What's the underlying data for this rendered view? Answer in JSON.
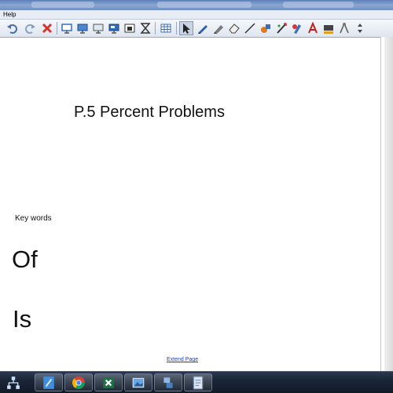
{
  "menubar": {
    "help_label": "Help"
  },
  "toolbar": {
    "tools": [
      "undo-icon",
      "redo-icon",
      "delete-icon",
      "screen-capture-icon",
      "monitor-icon",
      "display-icon",
      "desktop-icon",
      "photo-icon",
      "crop-icon",
      "table-icon",
      "select-arrow-icon",
      "pen-icon",
      "highlighter-icon",
      "eraser-icon",
      "line-icon",
      "fill-icon",
      "magic-pen-icon",
      "shape-recognition-icon",
      "text-icon",
      "fill-color-icon",
      "compass-icon",
      "move-icon"
    ]
  },
  "canvas": {
    "title": "P.5 Percent Problems",
    "key_words_label": "Key words",
    "word_1": "Of",
    "word_2": "Is",
    "extend_page_link": "Extend Page"
  },
  "taskbar": {
    "apps": [
      "notebook-app-icon",
      "chrome-icon",
      "excel-icon",
      "photo-viewer-icon",
      "network-app-icon",
      "document-app-icon"
    ]
  },
  "colors": {
    "link": "#1a3fc2",
    "taskbar": "#1a2536",
    "toolbar": "#dfe6f0"
  }
}
